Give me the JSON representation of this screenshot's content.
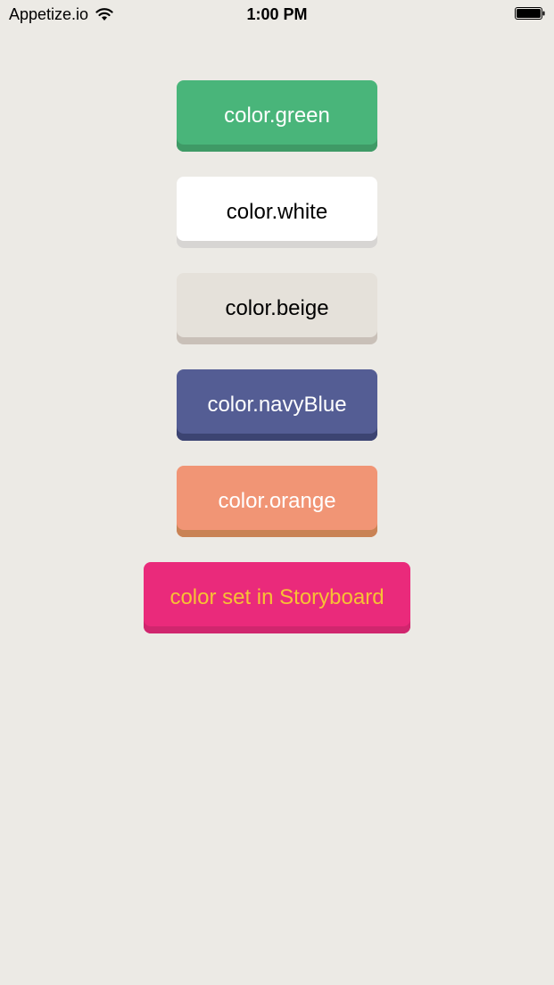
{
  "status_bar": {
    "carrier": "Appetize.io",
    "time": "1:00 PM",
    "icons": [
      "wifi-icon",
      "battery-icon"
    ]
  },
  "buttons": {
    "green": "color.green",
    "white": "color.white",
    "beige": "color.beige",
    "navy_blue": "color.navyBlue",
    "orange": "color.orange",
    "storyboard": "color set in Storyboard"
  },
  "colors": {
    "background": "#ECEAE5",
    "green": "#49B57A",
    "white": "#FFFFFF",
    "beige": "#E5E1DA",
    "navy_blue": "#545D94",
    "orange": "#F19575",
    "storyboard_pink": "#EA2A7B",
    "storyboard_text": "#F7C135"
  }
}
